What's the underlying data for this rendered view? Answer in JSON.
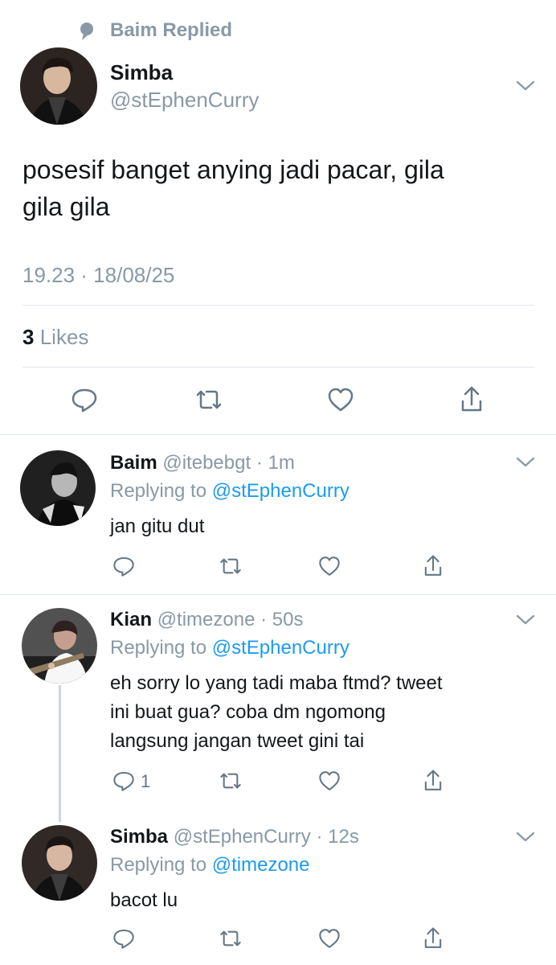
{
  "social_context": {
    "icon": "speech-bubble-icon",
    "label": "Baim Replied"
  },
  "main_tweet": {
    "name": "Simba",
    "handle": "@stEphenCurry",
    "text_line1": "posesif banget anying jadi pacar, gila",
    "text_line2": "gila gila",
    "timestamp": "19.23 · 18/08/25",
    "likes_count": "3",
    "likes_label": "Likes"
  },
  "replies": [
    {
      "name": "Baim",
      "handle": "@itebebgt",
      "time": "· 1m",
      "replying_prefix": "Replying to",
      "replying_to": "@stEphenCurry",
      "text": [
        "jan gitu dut"
      ],
      "reply_count": ""
    },
    {
      "name": "Kian",
      "handle": "@timezone",
      "time": "· 50s",
      "replying_prefix": "Replying to",
      "replying_to": "@stEphenCurry",
      "text": [
        "eh sorry lo yang tadi maba ftmd? tweet",
        "ini buat gua? coba dm ngomong",
        "langsung jangan tweet gini tai"
      ],
      "reply_count": "1"
    },
    {
      "name": "Simba",
      "handle": "@stEphenCurry",
      "time": "· 12s",
      "replying_prefix": "Replying to",
      "replying_to": "@timezone",
      "text": [
        "bacot lu"
      ],
      "reply_count": ""
    }
  ],
  "colors": {
    "text": "#14171a",
    "muted": "#8899a6",
    "link": "#1d9bf0",
    "divider": "#e1e8ed"
  }
}
